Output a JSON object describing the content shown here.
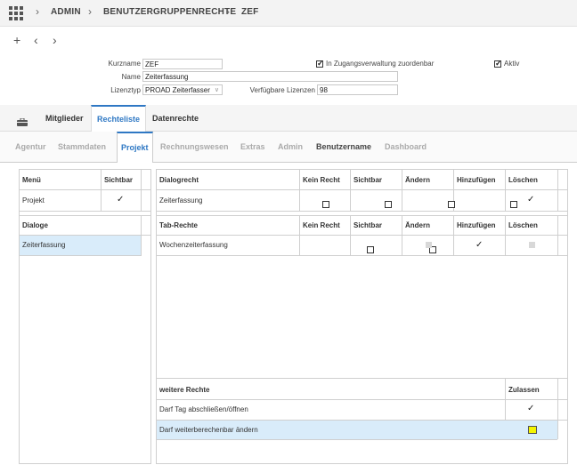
{
  "breadcrumb": [
    "ADMIN",
    "BENUTZERGRUPPENRECHTE",
    "ZEF"
  ],
  "toolbar": {
    "add": "+",
    "prev": "‹",
    "next": "›"
  },
  "form": {
    "kurzname_label": "Kurzname",
    "kurzname_value": "ZEF",
    "name_label": "Name",
    "name_value": "Zeiterfassung",
    "lizenztyp_label": "Lizenztyp",
    "lizenztyp_value": "PROAD Zeiterfasser",
    "verf_label": "Verfügbare Lizenzen",
    "verf_value": "98",
    "zuordnen_label": "In Zugangsverwaltung zuordenbar",
    "zuordnen_checked": true,
    "aktiv_label": "Aktiv",
    "aktiv_checked": true
  },
  "main_tabs": [
    "Mitglieder",
    "Rechteliste",
    "Datenrechte"
  ],
  "main_tab_active": "Rechteliste",
  "sub_tabs": [
    "Agentur",
    "Stammdaten",
    "Projekt",
    "Rechnungswesen",
    "Extras",
    "Admin",
    "Benutzername",
    "Dashboard"
  ],
  "sub_tab_active": "Projekt",
  "menu_panel": {
    "col1": "Menü",
    "col2": "Sichtbar",
    "row_label": "Projekt",
    "row_visible": true
  },
  "dialoge_panel": {
    "header": "Dialoge",
    "item": "Zeiterfassung"
  },
  "dialogrecht_panel": {
    "headers": [
      "Dialogrecht",
      "Kein Recht",
      "Sichtbar",
      "Ändern",
      "Hinzufügen",
      "Löschen"
    ],
    "row": {
      "label": "Zeiterfassung",
      "cells": [
        "box",
        "box",
        "box",
        "box",
        "check"
      ]
    }
  },
  "tabrechte_panel": {
    "headers": [
      "Tab-Rechte",
      "Kein Recht",
      "Sichtbar",
      "Ändern",
      "Hinzufügen",
      "Löschen"
    ],
    "row": {
      "label": "Wochenzeiterfassung",
      "cells": [
        "box",
        "box",
        "grey",
        "check",
        "grey"
      ]
    }
  },
  "weitere_panel": {
    "headers": [
      "weitere Rechte",
      "Zulassen"
    ],
    "rows": [
      {
        "label": "Darf Tag abschließen/öffnen",
        "value": "check"
      },
      {
        "label": "Darf weiterberechenbar ändern",
        "value": "yellow-box"
      }
    ]
  },
  "colors": {
    "accent": "#2f78c4",
    "highlight": "#d9ecfa",
    "focus": "#f4f400"
  }
}
